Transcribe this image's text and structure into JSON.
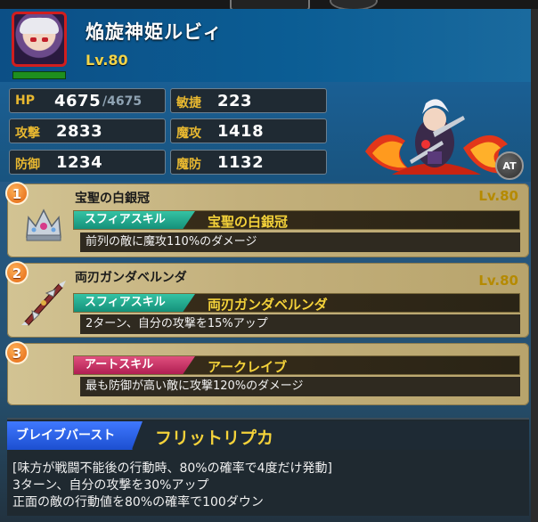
{
  "character": {
    "name": "焔旋神姫ルビィ",
    "level": "Lv.80"
  },
  "stats": {
    "hp_label": "HP",
    "hp_value": "4675",
    "hp_max": "/4675",
    "atk_label": "攻撃",
    "atk_value": "2833",
    "def_label": "防御",
    "def_value": "1234",
    "agi_label": "敏捷",
    "agi_value": "223",
    "matk_label": "魔攻",
    "matk_value": "1418",
    "mdef_label": "魔防",
    "mdef_value": "1132"
  },
  "at_button": "AT",
  "skills": [
    {
      "number": "1",
      "equip_name": "宝聖の白銀冠",
      "level": "Lv.80",
      "tag": "スフィアスキル",
      "skill_name": "宝聖の白銀冠",
      "desc": "前列の敵に魔攻110%のダメージ",
      "icon": "silver-crown-icon"
    },
    {
      "number": "2",
      "equip_name": "両刃ガンダベルンダ",
      "level": "Lv.80",
      "tag": "スフィアスキル",
      "skill_name": "両刃ガンダベルンダ",
      "desc": "2ターン、自分の攻撃を15%アップ",
      "icon": "double-blade-icon"
    },
    {
      "number": "3",
      "tag": "アートスキル",
      "skill_name": "アークレイブ",
      "desc": "最も防御が高い敵に攻撃120%のダメージ"
    }
  ],
  "brave_burst": {
    "tag": "ブレイブバースト",
    "name": "フリットリプカ",
    "lines": [
      "[味方が戦闘不能後の行動時、80%の確率で4度だけ発動]",
      "3ターン、自分の攻撃を30%アップ",
      "正面の敵の行動値を80%の確率で100ダウン"
    ]
  },
  "colors": {
    "accent_gold": "#f4d23a",
    "sphere_tag": "#15917a",
    "art_tag": "#b01e52",
    "brave_tag": "#2a5ad8",
    "hp_bar": "#1e8f1e"
  }
}
